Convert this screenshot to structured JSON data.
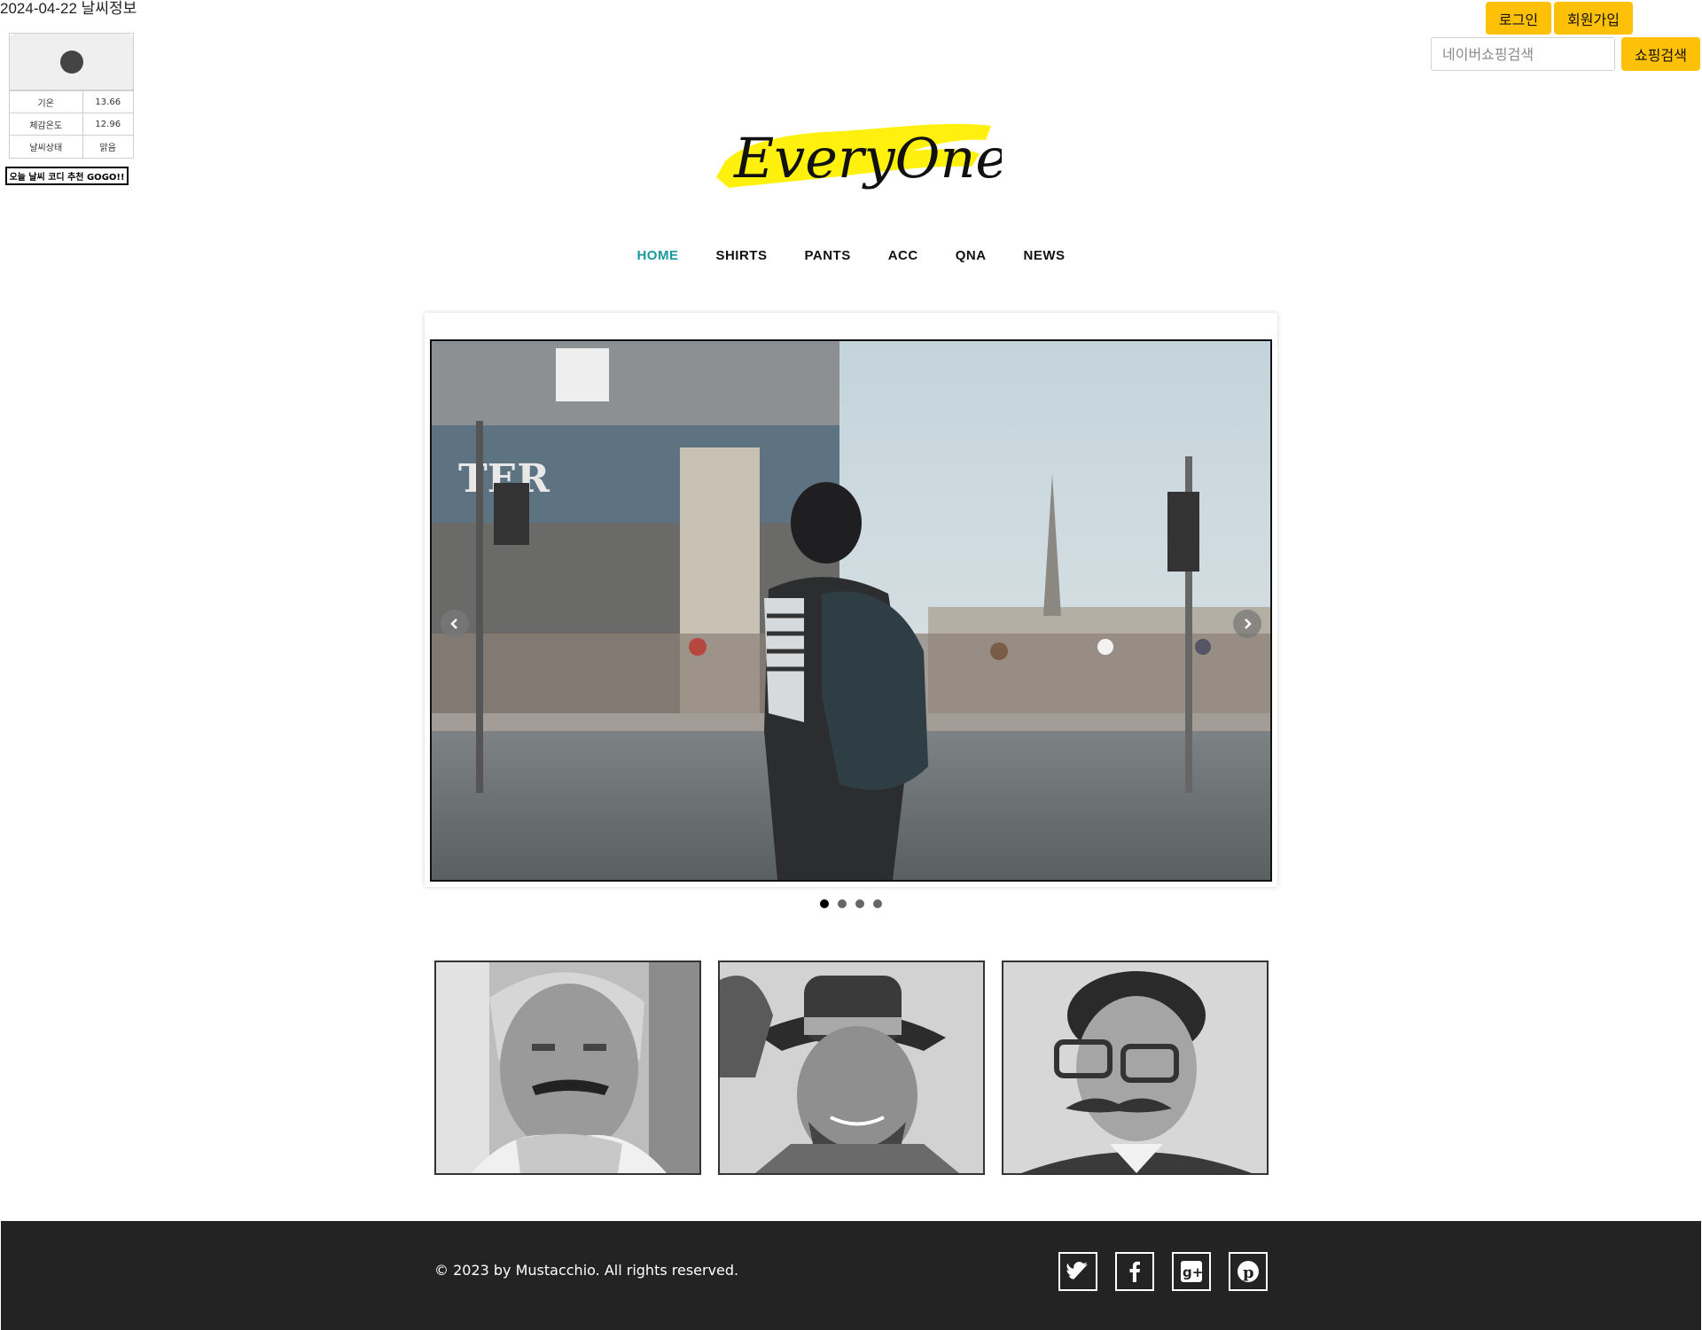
{
  "weather": {
    "title": "2024-04-22 날씨정보",
    "icon": "weather-icon",
    "rows": [
      {
        "label": "기온",
        "value": "13.66"
      },
      {
        "label": "체감온도",
        "value": "12.96"
      },
      {
        "label": "날씨상태",
        "value": "맑음"
      }
    ],
    "coordi_button": "오늘 날씨 코디 추천 GOGO!!"
  },
  "header": {
    "login": "로그인",
    "signup": "회원가입",
    "search_placeholder": "네이버쇼핑검색",
    "search_button": "쇼핑검색"
  },
  "logo": {
    "text": "EveryOne",
    "accent": "#fff000"
  },
  "nav": {
    "items": [
      "HOME",
      "SHIRTS",
      "PANTS",
      "ACC",
      "QNA",
      "NEWS"
    ],
    "active_index": 0,
    "active_color": "#17999e"
  },
  "slider": {
    "slide_count": 4,
    "active_slide": 0,
    "prev_icon": "chevron-left-icon",
    "next_icon": "chevron-right-icon"
  },
  "footer": {
    "copyright": "© 2023 by Mustacchio. All rights reserved.",
    "social": [
      "twitter-icon",
      "facebook-icon",
      "google-plus-icon",
      "pinterest-icon"
    ],
    "background": "#232323"
  }
}
